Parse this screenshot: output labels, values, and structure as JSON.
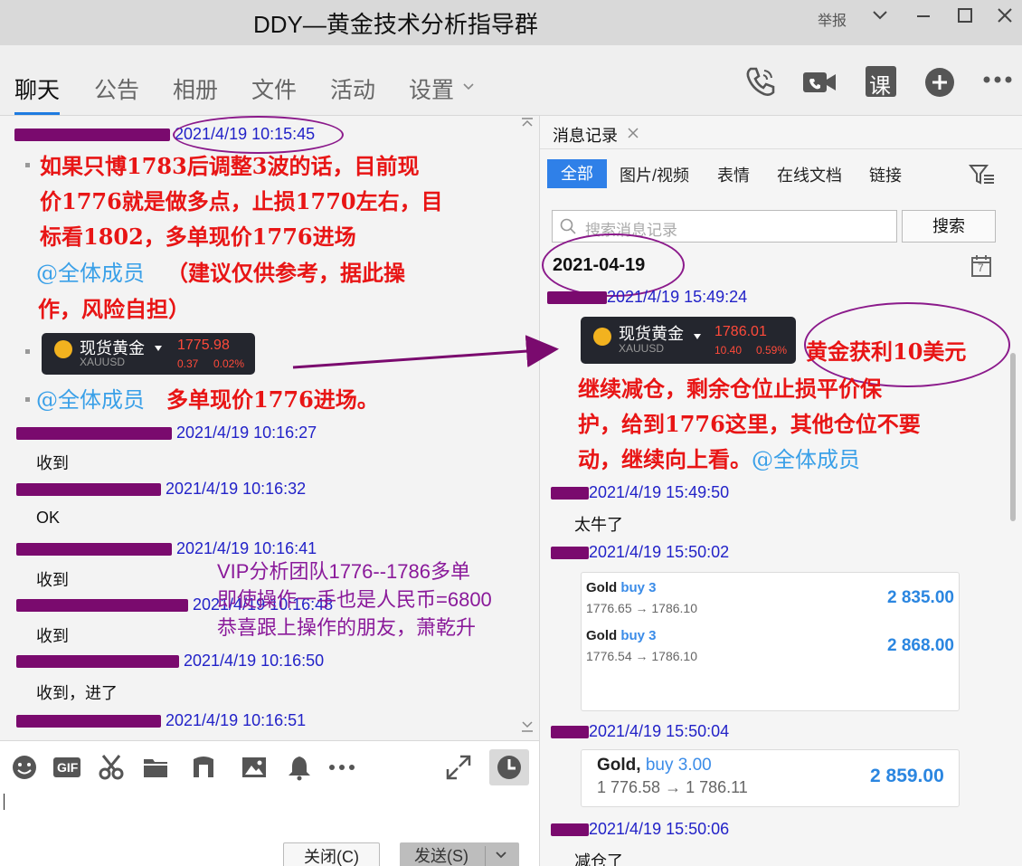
{
  "window": {
    "title": "DDY—黄金技术分析指导群",
    "report_label": "举报"
  },
  "tabs": [
    {
      "label": "聊天",
      "active": true
    },
    {
      "label": "公告"
    },
    {
      "label": "相册"
    },
    {
      "label": "文件"
    },
    {
      "label": "活动"
    },
    {
      "label": "设置"
    }
  ],
  "toolbar_icons": [
    "voice-call-icon",
    "video-call-icon",
    "class-icon",
    "add-icon",
    "more-icon"
  ],
  "toolbar": {
    "class_label": "课"
  },
  "chat": {
    "msg1": {
      "time": "2021/4/19 10:15:45",
      "lines": [
        "如果只博1783后调整3波的话，目前现",
        "价1776就是做多点，止损1770左右，目",
        "标看1802，多单现价1776进场"
      ],
      "mention": "@全体成员",
      "line4_rest": "（建议仅供参考，据此操",
      "line5": "作，风险自担）"
    },
    "quote_card": {
      "name": "现货黄金",
      "symbol": "XAUUSD",
      "price": "1775.98",
      "change": "0.37",
      "change_pct": "0.02%"
    },
    "msg2": {
      "mention": "@全体成员",
      "text": "多单现价1776进场。"
    },
    "replies": [
      {
        "time": "2021/4/19 10:16:27",
        "text": "收到"
      },
      {
        "time": "2021/4/19 10:16:32",
        "text": "OK"
      },
      {
        "time": "2021/4/19 10:16:41",
        "text": "收到"
      },
      {
        "time": "2021/4/19 10:16:48",
        "text": "收到"
      },
      {
        "time": "2021/4/19 10:16:50",
        "text": "收到，进了"
      },
      {
        "time": "2021/4/19 10:16:51",
        "text": ""
      }
    ],
    "overlay_note": [
      "VIP分析团队1776--1786多单",
      "即使操作一手也是人民币=6800",
      "恭喜跟上操作的朋友，萧乾升"
    ]
  },
  "input_icons": [
    "emoji-icon",
    "gif-icon",
    "scissors-icon",
    "folder-icon",
    "music-icon",
    "image-icon",
    "bell-icon",
    "more-icon",
    "expand-icon",
    "history-clock-icon"
  ],
  "input": {
    "gif_label": "GIF",
    "close_label": "关闭(C)",
    "send_label": "发送(S)"
  },
  "history": {
    "tab_label": "消息记录",
    "filters": [
      "全部",
      "图片/视频",
      "表情",
      "在线文档",
      "链接"
    ],
    "search_placeholder": "搜索消息记录",
    "search_button": "搜索",
    "date": "2021-04-19",
    "calendar_day": "7",
    "msg1_time": "2021/4/19 15:49:24",
    "quote_card": {
      "name": "现货黄金",
      "symbol": "XAUUSD",
      "price": "1786.01",
      "change": "10.40",
      "change_pct": "0.59%"
    },
    "msg1_lines": [
      "黄金获利10美元",
      "继续减仓，剩余仓位止损平价保",
      "护，给到1776这里，其他仓位不要",
      "动，继续向上看。"
    ],
    "msg1_mention": "@全体成员",
    "msg2": {
      "time": "2021/4/19 15:49:50",
      "text": "太牛了"
    },
    "msg3_time": "2021/4/19 15:50:02",
    "trades1": [
      {
        "name": "Gold",
        "action": "buy 3",
        "prices": "1776.65 → 1786.10",
        "profit": "2 835.00"
      },
      {
        "name": "Gold",
        "action": "buy 3",
        "prices": "1776.54 → 1786.10",
        "profit": "2 868.00"
      }
    ],
    "msg4_time": "2021/4/19 15:50:04",
    "trade2": {
      "name": "Gold,",
      "action": "buy 3.00",
      "prices": "1 776.58 → 1 786.11",
      "profit": "2 859.00"
    },
    "msg5_time": "2021/4/19 15:50:06",
    "msg5_text": "减仓了"
  },
  "colors": {
    "accent": "#2f80e8",
    "red_text": "#e81515",
    "mention": "#3aa0e8",
    "meta_blue": "#2222c8",
    "annotation_purple": "#8b1a8b",
    "redaction": "#7a0a6e"
  }
}
